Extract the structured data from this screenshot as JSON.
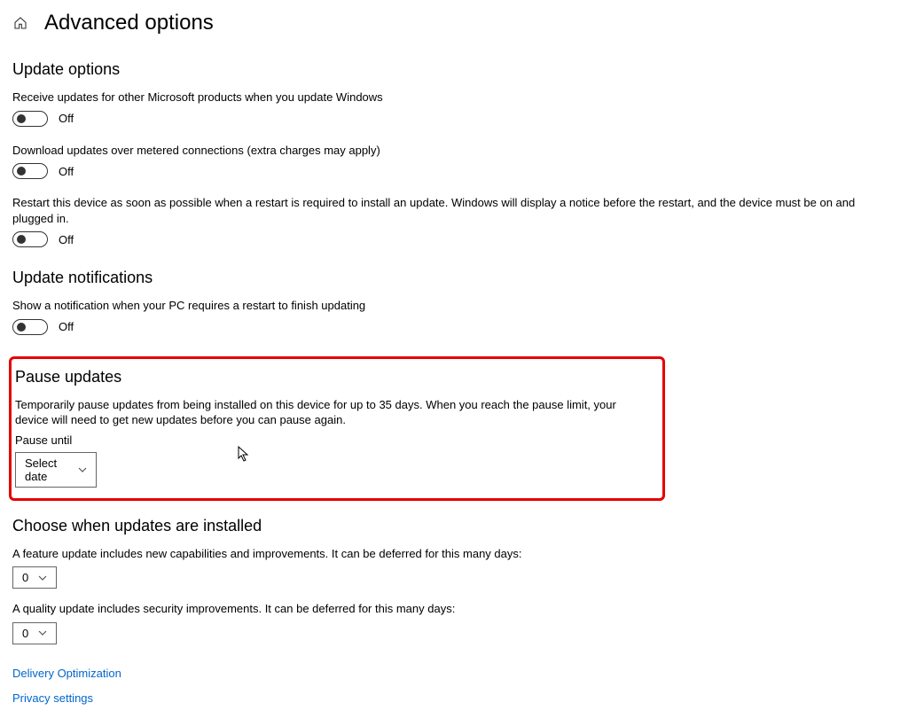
{
  "header": {
    "title": "Advanced options"
  },
  "section_update_options": {
    "heading": "Update options",
    "opt1_desc": "Receive updates for other Microsoft products when you update Windows",
    "opt1_state": "Off",
    "opt2_desc": "Download updates over metered connections (extra charges may apply)",
    "opt2_state": "Off",
    "opt3_desc": "Restart this device as soon as possible when a restart is required to install an update. Windows will display a notice before the restart, and the device must be on and plugged in.",
    "opt3_state": "Off"
  },
  "section_notifications": {
    "heading": "Update notifications",
    "desc": "Show a notification when your PC requires a restart to finish updating",
    "state": "Off"
  },
  "section_pause": {
    "heading": "Pause updates",
    "desc": "Temporarily pause updates from being installed on this device for up to 35 days. When you reach the pause limit, your device will need to get new updates before you can pause again.",
    "sublabel": "Pause until",
    "dropdown_value": "Select date"
  },
  "section_choose": {
    "heading": "Choose when updates are installed",
    "feature_desc": "A feature update includes new capabilities and improvements. It can be deferred for this many days:",
    "feature_value": "0",
    "quality_desc": "A quality update includes security improvements. It can be deferred for this many days:",
    "quality_value": "0"
  },
  "links": {
    "delivery": "Delivery Optimization",
    "privacy": "Privacy settings"
  }
}
